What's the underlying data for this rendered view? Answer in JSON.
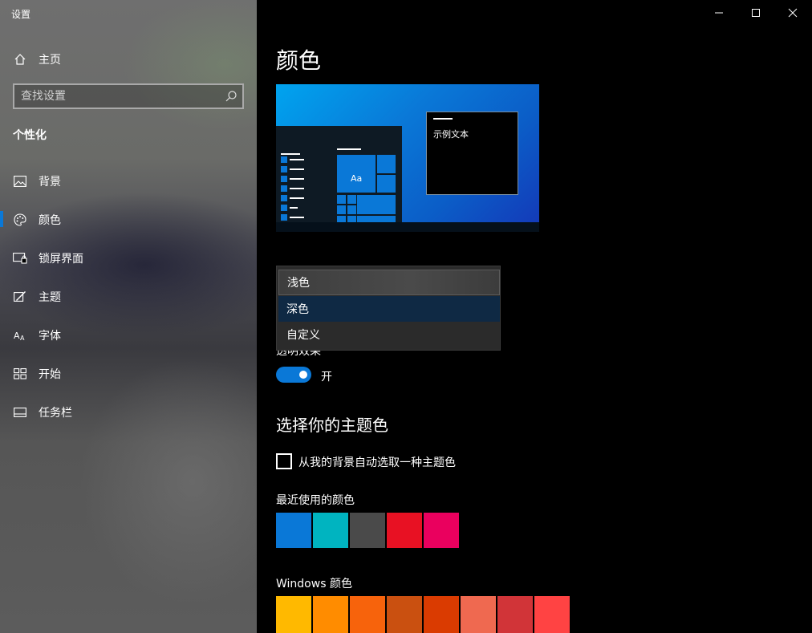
{
  "window": {
    "title": "设置"
  },
  "sidebar": {
    "home_label": "主页",
    "search_placeholder": "查找设置",
    "section_title": "个性化",
    "items": [
      {
        "label": "背景",
        "icon": "picture-icon"
      },
      {
        "label": "颜色",
        "icon": "palette-icon",
        "selected": true
      },
      {
        "label": "锁屏界面",
        "icon": "lock-screen-icon"
      },
      {
        "label": "主题",
        "icon": "theme-brush-icon"
      },
      {
        "label": "字体",
        "icon": "font-icon"
      },
      {
        "label": "开始",
        "icon": "start-grid-icon"
      },
      {
        "label": "任务栏",
        "icon": "taskbar-icon"
      }
    ]
  },
  "main": {
    "title": "颜色",
    "preview": {
      "sample_text": "示例文本",
      "tile_text": "Aa"
    },
    "color_mode_dropdown": {
      "options": [
        "浅色",
        "深色",
        "自定义"
      ],
      "highlighted": "浅色",
      "selected": "深色"
    },
    "transparency": {
      "label": "透明效果",
      "state": "开",
      "on": true
    },
    "accent": {
      "title": "选择你的主题色",
      "auto_pick_label": "从我的背景自动选取一种主题色",
      "auto_pick_checked": false
    },
    "recent_colors": {
      "label": "最近使用的颜色",
      "colors": [
        "#0a78d7",
        "#00b4c0",
        "#4a4a4a",
        "#e81123",
        "#ea005e"
      ]
    },
    "windows_colors": {
      "label": "Windows 颜色",
      "colors": [
        "#ffb900",
        "#ff8c00",
        "#f7630c",
        "#ca5010",
        "#da3b01",
        "#ef6950",
        "#d13438",
        "#ff4343"
      ]
    }
  },
  "theme": {
    "accent": "#0a78d7"
  }
}
